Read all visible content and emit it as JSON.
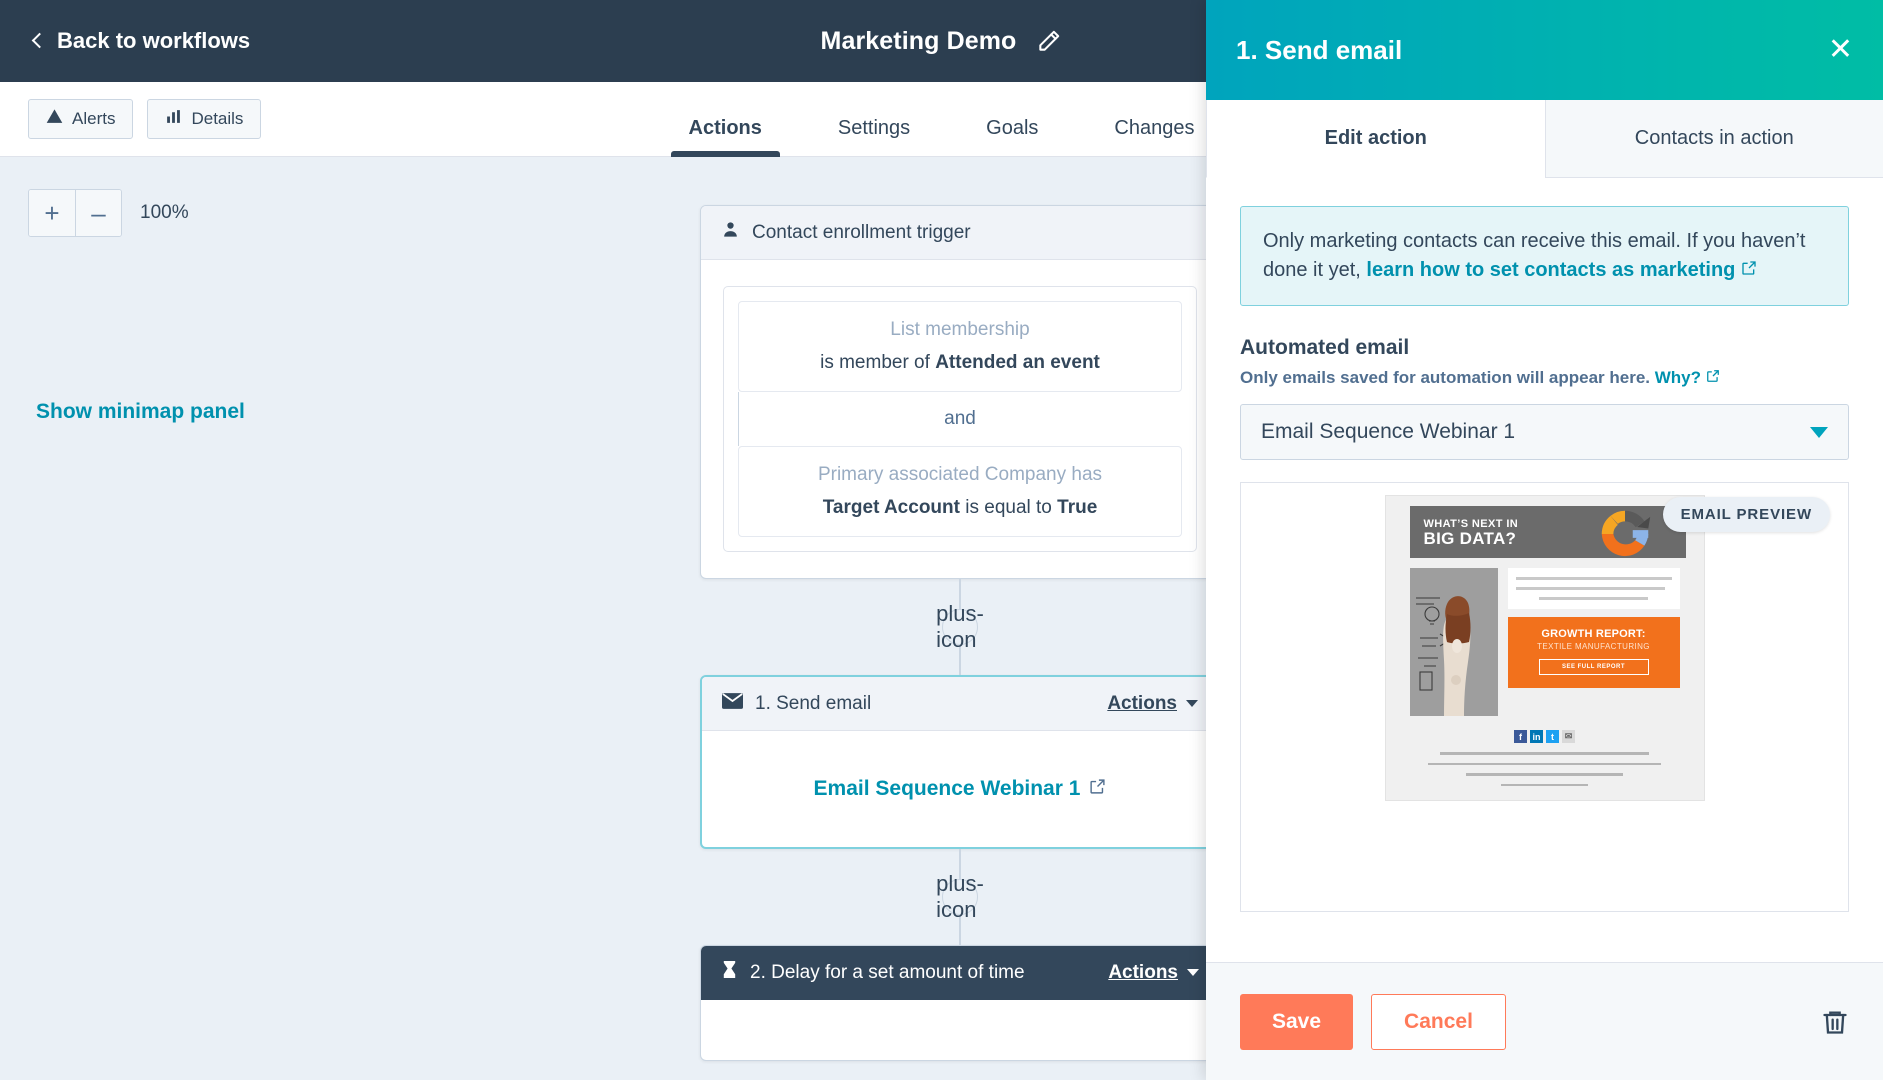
{
  "topnav": {
    "back_label": "Back to workflows",
    "workflow_title": "Marketing Demo",
    "edit_icon": "pencil-icon"
  },
  "subheader": {
    "buttons": [
      {
        "label": "Alerts",
        "icon": "warning-triangle-icon"
      },
      {
        "label": "Details",
        "icon": "bar-chart-icon"
      }
    ],
    "tabs": [
      {
        "label": "Actions",
        "active": true
      },
      {
        "label": "Settings",
        "active": false
      },
      {
        "label": "Goals",
        "active": false
      },
      {
        "label": "Changes",
        "active": false
      }
    ]
  },
  "canvas": {
    "zoom_in": "+",
    "zoom_out": "–",
    "zoom_level": "100%",
    "minimap_link": "Show minimap panel",
    "trigger": {
      "header": "Contact enrollment trigger",
      "icon": "contact-person-icon",
      "criteria": [
        {
          "label": "List membership",
          "prefix": "is member of ",
          "bold": "Attended an event",
          "suffix": ""
        },
        {
          "label": "Primary associated Company has",
          "prefix": "",
          "bold": "Target Account",
          "mid": " is equal to ",
          "bold2": "True"
        }
      ],
      "conjunction": "and"
    },
    "actions": [
      {
        "header": "1. Send email",
        "icon": "envelope-icon",
        "menu_label": "Actions",
        "body_link": "Email Sequence Webinar 1",
        "selected": true
      },
      {
        "header": "2. Delay for a set amount of time",
        "icon": "hourglass-icon",
        "menu_label": "Actions",
        "selected": false
      }
    ],
    "add_step_icon": "plus-icon"
  },
  "panel": {
    "title": "1. Send email",
    "close_icon": "close-icon",
    "tabs": [
      {
        "label": "Edit action",
        "active": true
      },
      {
        "label": "Contacts in action",
        "active": false
      }
    ],
    "info": {
      "text_before": "Only marketing contacts can receive this email. If you haven’t done it yet, ",
      "link_text": "learn how to set contacts as marketing",
      "link_icon": "external-link-icon"
    },
    "email_field": {
      "label": "Automated email",
      "help_text": "Only emails saved for automation will appear here. ",
      "help_link": "Why?",
      "help_link_icon": "external-link-icon",
      "selected_value": "Email Sequence Webinar 1",
      "caret_icon": "chevron-down-icon"
    },
    "preview": {
      "badge": "EMAIL PREVIEW",
      "email": {
        "headline_small": "WHAT’S NEXT IN",
        "headline_large": "BIG DATA?",
        "logo": "google-g-logo",
        "photo_alt": "woman-facing-wall-illustration",
        "cta_title": "GROWTH REPORT:",
        "cta_subtitle": "TEXTILE MANUFACTURING",
        "cta_button": "SEE FULL REPORT",
        "social_icons": [
          "facebook-icon",
          "linkedin-icon",
          "twitter-icon",
          "email-icon"
        ]
      }
    },
    "footer": {
      "save_label": "Save",
      "cancel_label": "Cancel",
      "delete_icon": "trash-icon"
    }
  },
  "colors": {
    "nav_bg": "#2c3e50",
    "panel_gradient_start": "#00a4bd",
    "panel_gradient_end": "#00bda5",
    "accent_link": "#0091ae",
    "primary_button": "#ff7a59",
    "canvas_bg": "#eaf0f6",
    "text": "#33475b"
  }
}
